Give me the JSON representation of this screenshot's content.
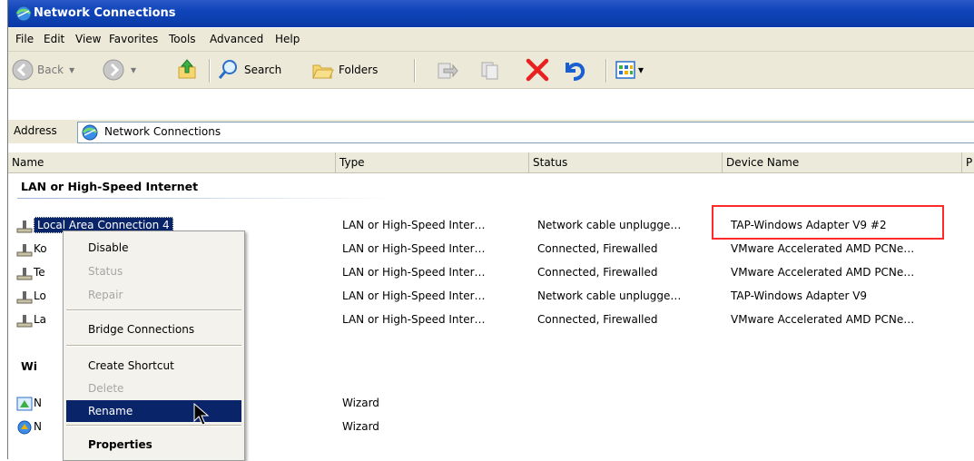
{
  "window": {
    "title": "Network Connections"
  },
  "menu": [
    "File",
    "Edit",
    "View",
    "Favorites",
    "Tools",
    "Advanced",
    "Help"
  ],
  "toolbar": {
    "back": "Back",
    "search": "Search",
    "folders": "Folders"
  },
  "address": {
    "label": "Address",
    "value": "Network Connections"
  },
  "columns": [
    "Name",
    "Type",
    "Status",
    "Device Name",
    "P"
  ],
  "groups": [
    {
      "title": "LAN or High-Speed Internet"
    },
    {
      "title": "Wi"
    }
  ],
  "rows": [
    {
      "name": "Local Area Connection 4",
      "type": "LAN or High-Speed Inter…",
      "status": "Network cable unplugge…",
      "device": "TAP-Windows Adapter V9 #2"
    },
    {
      "name": "Ko",
      "type": "LAN or High-Speed Inter…",
      "status": "Connected, Firewalled",
      "device": "VMware Accelerated AMD PCNe…"
    },
    {
      "name": "Te",
      "type": "LAN or High-Speed Inter…",
      "status": "Connected, Firewalled",
      "device": "VMware Accelerated AMD PCNe…"
    },
    {
      "name": "Lo",
      "type": "LAN or High-Speed Inter…",
      "status": "Network cable unplugge…",
      "device": "TAP-Windows Adapter V9"
    },
    {
      "name": "La",
      "type": "LAN or High-Speed Inter…",
      "status": "Connected, Firewalled",
      "device": "VMware Accelerated AMD PCNe…"
    }
  ],
  "wizard_rows": [
    {
      "name": "N",
      "type": "Wizard"
    },
    {
      "name": "N",
      "type": "Wizard"
    }
  ],
  "context_menu": [
    "Disable",
    "Status",
    "Repair",
    "Bridge Connections",
    "Create Shortcut",
    "Delete",
    "Rename",
    "Properties"
  ],
  "icons": {
    "window": "network-globe-icon",
    "connection": "network-plug-icon",
    "cursor": "mouse-pointer-icon"
  }
}
